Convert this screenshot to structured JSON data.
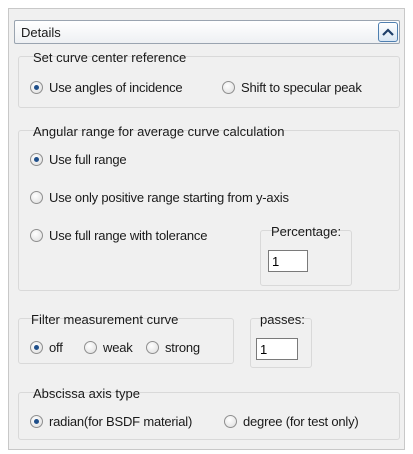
{
  "header": {
    "title": "Details",
    "collapse_icon": "chevron-up-icon"
  },
  "center_reference": {
    "legend": "Set curve center reference",
    "options": [
      {
        "label": "Use angles of incidence",
        "checked": true
      },
      {
        "label": "Shift to specular peak",
        "checked": false
      }
    ]
  },
  "angular_range": {
    "legend": "Angular range for average curve calculation",
    "options": [
      {
        "label": "Use full range",
        "checked": true
      },
      {
        "label": "Use only positive range starting from y-axis",
        "checked": false
      },
      {
        "label": "Use full range with tolerance",
        "checked": false
      }
    ],
    "percentage": {
      "legend": "Percentage:",
      "value": "1"
    }
  },
  "filter": {
    "legend": "Filter measurement curve",
    "options": [
      {
        "label": "off",
        "checked": true
      },
      {
        "label": "weak",
        "checked": false
      },
      {
        "label": "strong",
        "checked": false
      }
    ],
    "passes": {
      "legend": "passes:",
      "value": "1"
    }
  },
  "abscissa": {
    "legend": "Abscissa axis type",
    "options": [
      {
        "label": "radian(for BSDF material)",
        "checked": true
      },
      {
        "label": "degree (for test only)",
        "checked": false
      }
    ]
  },
  "colors": {
    "accent": "#1f4f8a",
    "panel_bg": "#f0f0f0",
    "border": "#d9d9d9"
  }
}
